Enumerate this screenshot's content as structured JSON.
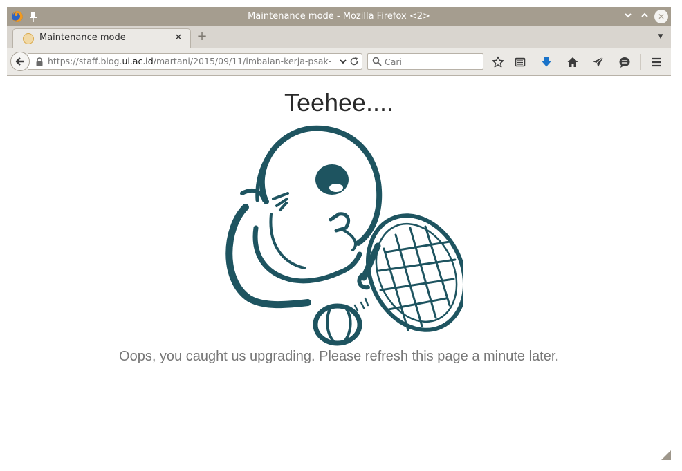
{
  "window": {
    "title": "Maintenance mode - Mozilla Firefox <2>",
    "minimize_label": "⌄",
    "maximize_label": "⌃",
    "close_label": "✕"
  },
  "tabs": [
    {
      "label": "Maintenance mode",
      "close_label": "✕",
      "active": true
    }
  ],
  "tabstrip": {
    "new_tab_label": "+",
    "menu_label": "▼"
  },
  "urlbar": {
    "prefix": "https://staff.blog.",
    "host": "ui.ac.id",
    "suffix": "/martani/2015/09/11/imbalan-kerja-psak-",
    "dropdown_label": "⌄"
  },
  "search": {
    "placeholder": "Cari",
    "value": ""
  },
  "toolbar_icons": [
    "star-icon",
    "reading-list-icon",
    "download-icon",
    "home-icon",
    "send-icon",
    "chat-icon",
    "menu-icon"
  ],
  "colors": {
    "accent": "#1e5460",
    "download": "#1a73c9",
    "titlebar": "#a59d8f"
  },
  "page": {
    "title": "Teehee....",
    "message": "Oops, you caught us upgrading. Please refresh this page a minute later."
  }
}
